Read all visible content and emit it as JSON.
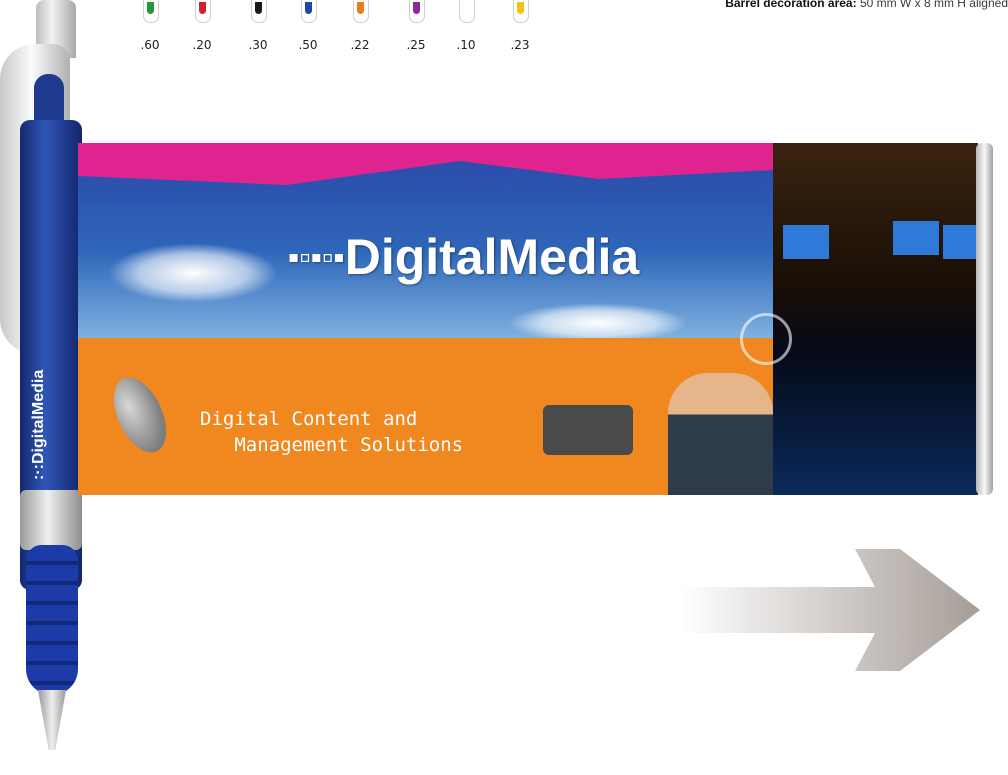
{
  "colors": [
    {
      "code": ".60",
      "ink": "#1f9a3a"
    },
    {
      "code": ".20",
      "ink": "#d3202a"
    },
    {
      "code": ".30",
      "ink": "#1a1a1a"
    },
    {
      "code": ".50",
      "ink": "#2146a8"
    },
    {
      "code": ".22",
      "ink": "#ef7a1a"
    },
    {
      "code": ".25",
      "ink": "#8a2a9a"
    },
    {
      "code": ".10",
      "ink": "#ffffff"
    },
    {
      "code": ".23",
      "ink": "#f2c217"
    }
  ],
  "barrel_note": {
    "label": "Barrel decoration area:",
    "value": "50 mm W x 8 mm H aligned"
  },
  "pen": {
    "label": ":·:DigitalMedia"
  },
  "banner": {
    "brand": "DigitalMedia",
    "tagline": "Digital Content and\n   Management Solutions"
  }
}
